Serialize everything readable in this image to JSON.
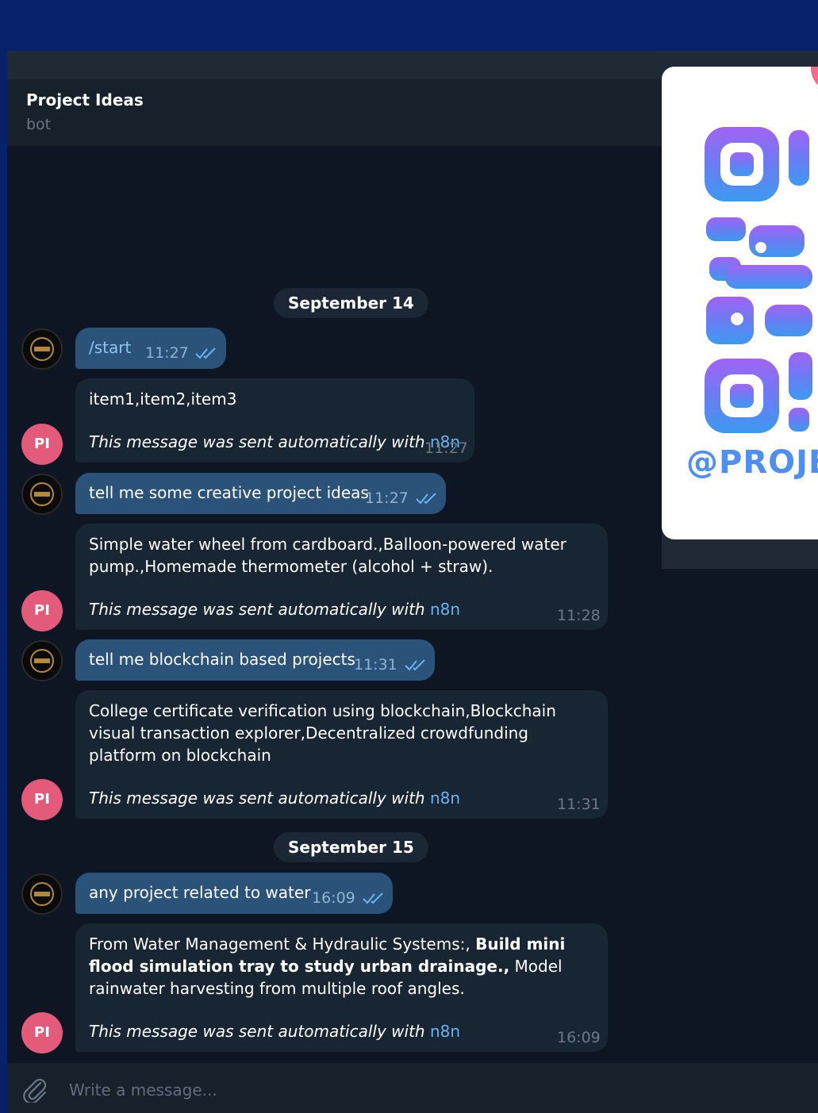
{
  "chat": {
    "title": "Project Ideas",
    "status": "bot"
  },
  "qr": {
    "handle": "@PROJE"
  },
  "dates": [
    "September 14",
    "September 15"
  ],
  "bot_avatar": "PI",
  "auto_note": {
    "prefix": "This message was sent automatically with",
    "link": "n8n"
  },
  "messages": [
    {
      "from": "user",
      "text": "/start",
      "time": "11:27"
    },
    {
      "from": "bot",
      "text": "item1,item2,item3",
      "time": "11:27"
    },
    {
      "from": "user",
      "text": "tell me some creative project ideas",
      "time": "11:27"
    },
    {
      "from": "bot",
      "text": "Simple water wheel from cardboard.,Balloon-powered water pump.,Homemade thermometer (alcohol + straw).",
      "time": "11:28"
    },
    {
      "from": "user",
      "text": "tell me blockchain based projects",
      "time": "11:31"
    },
    {
      "from": "bot",
      "text": "College certificate verification using blockchain,Blockchain visual transaction explorer,Decentralized crowdfunding platform on blockchain",
      "time": "11:31"
    },
    {
      "from": "user",
      "text": "any project related to water",
      "time": "16:09"
    },
    {
      "from": "bot",
      "text_parts": [
        "From Water Management & Hydraulic Systems:, ",
        "Build mini flood simulation tray to study urban drainage.,",
        " Model rainwater harvesting from multiple roof angles."
      ],
      "time": "16:09"
    }
  ],
  "composer": {
    "placeholder": "Write a message..."
  }
}
